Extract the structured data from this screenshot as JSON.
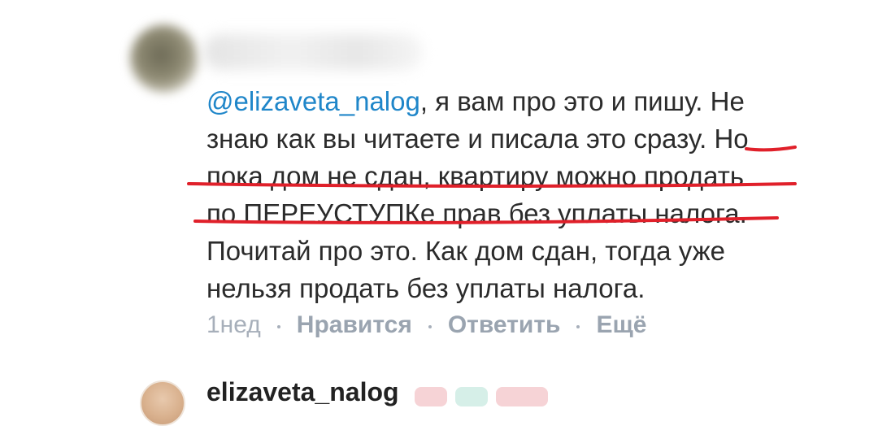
{
  "comment": {
    "mention": "@elizaveta_nalog",
    "lines": [
      ", я вам про это и пишу. Не",
      "знаю как вы читаете и писала это сразу. Но",
      "пока дом не сдан, квартиру можно продать",
      "по ПЕРЕУСТУПКе прав без уплаты налога.",
      "Почитай про это. Как дом сдан, тогда уже",
      "нельзя продать без уплаты налога."
    ],
    "highlight_color": "#e0202a"
  },
  "meta": {
    "time": "1нед",
    "like": "Нравится",
    "reply": "Ответить",
    "more": "Ещё"
  },
  "next_comment": {
    "name": "elizaveta_nalog"
  },
  "colors": {
    "mention": "#1f86c9",
    "text": "#2b2b2b",
    "meta": "#9aa4b0"
  }
}
